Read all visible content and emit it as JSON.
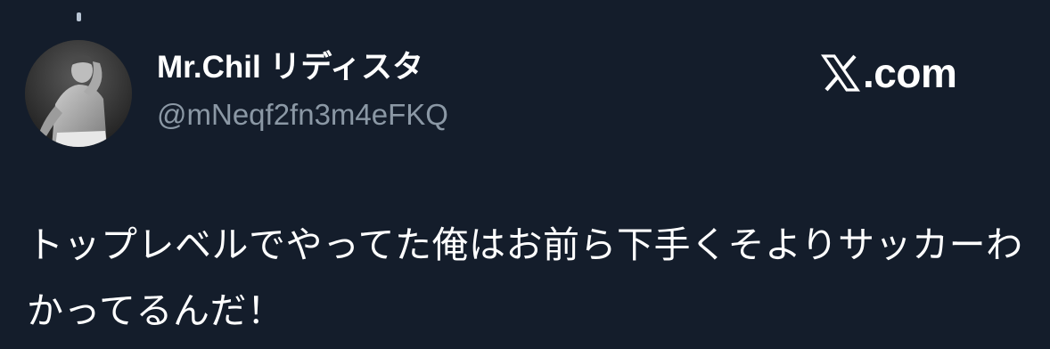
{
  "post": {
    "author": {
      "display_name": "Mr.Chil リディスタ",
      "handle": "@mNeqf2fn3m4eFKQ"
    },
    "text": "トップレベルでやってた俺はお前ら下手くそよりサッカーわかってるんだ！"
  },
  "brand": {
    "domain": "X.com",
    "domain_suffix": ".com",
    "icon": "x-logo-icon"
  },
  "colors": {
    "background": "#141d2b",
    "text_primary": "#ffffff",
    "text_secondary": "#8b98a5"
  }
}
